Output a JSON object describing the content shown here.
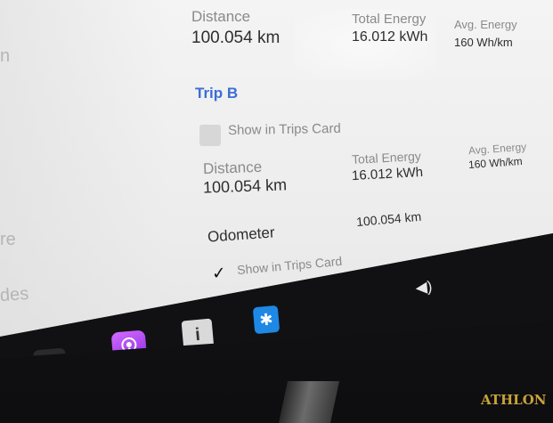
{
  "sidebar": {
    "items": [
      "n",
      "re",
      "des"
    ]
  },
  "trip_a": {
    "distance_label": "Distance",
    "distance_value": "100.054 km",
    "total_energy_label": "Total Energy",
    "total_energy_value": "16.012 kWh",
    "avg_energy_label": "Avg. Energy",
    "avg_energy_value": "160 Wh/km"
  },
  "trip_b": {
    "title": "Trip B",
    "show_in_trips_label": "Show in Trips Card",
    "show_in_trips_checked": false,
    "distance_label": "Distance",
    "distance_value": "100.054 km",
    "total_energy_label": "Total Energy",
    "total_energy_value": "16.012 kWh",
    "avg_energy_label": "Avg. Energy",
    "avg_energy_value": "160 Wh/km"
  },
  "odometer": {
    "label": "Odometer",
    "value": "100.054 km",
    "show_in_trips_label": "Show in Trips Card",
    "show_in_trips_checked": true,
    "check_glyph": "✓"
  },
  "taskbar": {
    "more_glyph": "•••",
    "manual_glyph": "i",
    "bluetooth_glyph": "✱",
    "volume_glyph": "◀)"
  },
  "bezel": {
    "brand": "ATHLON"
  },
  "colors": {
    "accent": "#3b6fd4",
    "podcast": "#b04cf0",
    "bluetooth": "#1e88e5"
  }
}
